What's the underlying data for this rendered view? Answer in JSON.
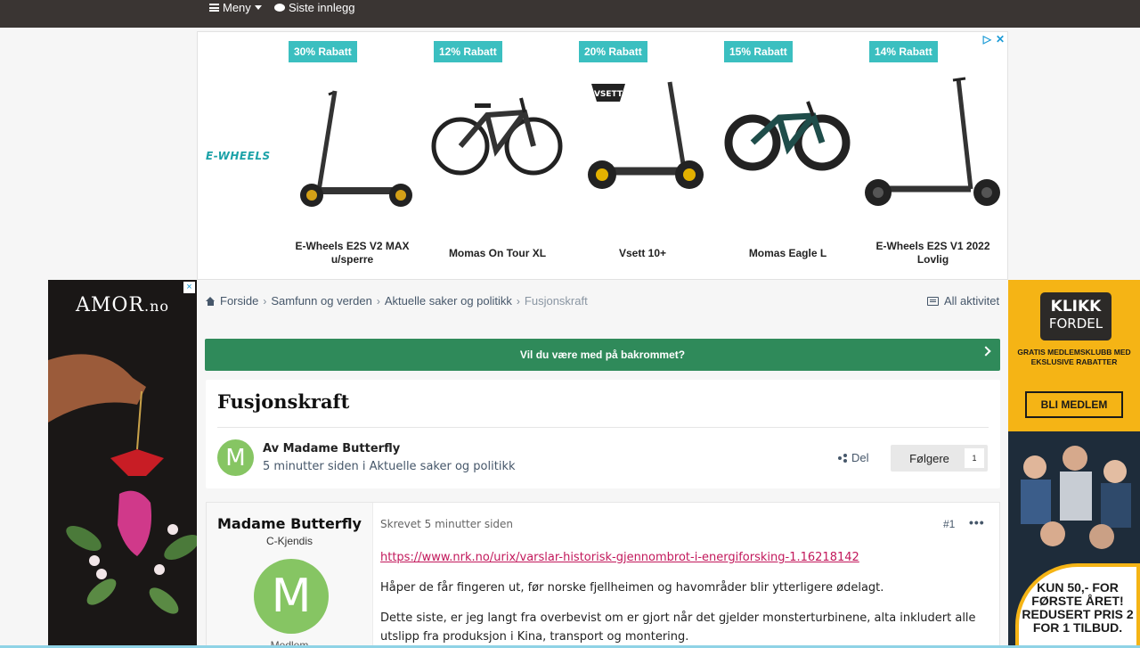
{
  "nav": {
    "menu_label": "Meny",
    "latest_label": "Siste innlegg"
  },
  "top_ad": {
    "brand": "E-WHEELS",
    "products": [
      {
        "discount": "30% Rabatt",
        "name": "E-Wheels E2S V2 MAX u/sperre",
        "image": "kick-scooter"
      },
      {
        "discount": "12% Rabatt",
        "name": "Momas On Tour XL",
        "image": "e-bike"
      },
      {
        "discount": "20% Rabatt",
        "name": "Vsett 10+",
        "image": "kick-scooter-offroad"
      },
      {
        "discount": "15% Rabatt",
        "name": "Momas Eagle L",
        "image": "fat-bike"
      },
      {
        "discount": "14% Rabatt",
        "name": "E-Wheels E2S V1 2022 Lovlig",
        "image": "kick-scooter"
      }
    ],
    "vsett_logo": "VSETT"
  },
  "left_ad": {
    "logo_main": "AMOR",
    "logo_suffix": ".no",
    "close": "×"
  },
  "right_ad": {
    "logo_line1": "KLIKK",
    "logo_line2": "FORDEL",
    "tagline": "GRATIS MEDLEMSKLUBB MED EKSLUSIVE RABATTER",
    "cta": "BLI MEDLEM",
    "offer": "KUN 50,- FOR FØRSTE ÅRET! REDUSERT PRIS 2 FOR 1 TILBUD."
  },
  "breadcrumb": {
    "items": [
      "Forside",
      "Samfunn og verden",
      "Aktuelle saker og politikk"
    ],
    "current": "Fusjonskraft"
  },
  "all_activity": "All aktivitet",
  "banner": "Vil du være med på bakrommet?",
  "topic": {
    "title": "Fusjonskraft",
    "avatar_letter": "M",
    "author_line": "Av Madame Butterfly",
    "meta_line": "5 minutter siden i Aktuelle saker og politikk",
    "share": "Del",
    "follow_label": "Følgere",
    "follow_count": "1"
  },
  "post": {
    "author": "Madame Butterfly",
    "rank": "C-Kjendis",
    "avatar_letter": "M",
    "sub": "Medlem",
    "date": "Skrevet 5 minutter siden",
    "number": "#1",
    "more": "•••",
    "link": "https://www.nrk.no/urix/varslar-historisk-gjennombrot-i-energiforsking-1.16218142",
    "paragraph1": "Håper de får fingeren ut, før norske fjellheimen og havområder blir ytterligere ødelagt.",
    "paragraph2": "Dette siste, er jeg langt fra overbevist om er gjort når det gjelder monsterturbinene, alta inkludert alle utslipp fra produksjon i Kina, transport og montering."
  },
  "colors": {
    "topbar": "#3a3533",
    "banner": "#2f8a5a",
    "discount": "#3bbfc0",
    "avatar": "#86c563",
    "link": "#c2185b"
  }
}
